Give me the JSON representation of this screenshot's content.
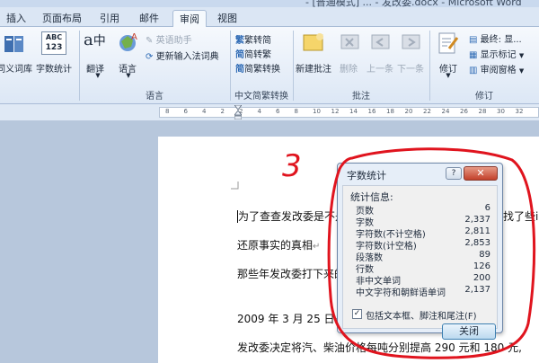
{
  "window": {
    "title": "- [普通模式] ... - 发改委.docx - Microsoft Word"
  },
  "tabs": [
    {
      "label": "插入"
    },
    {
      "label": "页面布局"
    },
    {
      "label": "引用"
    },
    {
      "label": "邮件"
    },
    {
      "label": "审阅"
    },
    {
      "label": "视图"
    }
  ],
  "ribbon": {
    "proofing": {
      "thesaurus": "同义词库",
      "word_count": "字数统计",
      "abc_text": "ABC",
      "num_text": "123"
    },
    "language": {
      "translate": "翻译",
      "language": "语言",
      "english_assistant": "英语助手",
      "update_ime": "更新输入法词典",
      "group": "语言"
    },
    "chinese_conversion": {
      "trad_to_simp": "繁转简",
      "simp_to_trad": "简转繁",
      "convert": "简繁转换",
      "group": "中文简繁转换"
    },
    "comments": {
      "new_comment": "新建批注",
      "delete": "删除",
      "previous": "上一条",
      "next": "下一条",
      "group": "批注"
    },
    "tracking": {
      "track_changes": "修订",
      "final_display": "最终: 显...",
      "show_markup": "显示标记",
      "review_pane": "审阅窗格",
      "group": "修订"
    }
  },
  "ruler": {
    "ticks": [
      "8",
      "6",
      "4",
      "2",
      "2",
      "4",
      "6",
      "8",
      "10",
      "12",
      "14",
      "16",
      "18",
      "20",
      "22",
      "24",
      "26",
      "28",
      "30",
      "32"
    ]
  },
  "document": {
    "lines": [
      "为了查查发改委是不是",
      "还原事实的真相",
      "那些年发改委打下来的",
      "2009 年 3 月 25 日",
      "发改委决定将汽、柴油价格每吨分别提高 290 元和 180 元,"
    ],
    "trailing": "找了些i",
    "return_mark": "↵"
  },
  "dialog": {
    "title": "字数统计",
    "help_label": "?",
    "close_label": "✕",
    "info_label": "统计信息:",
    "stats": [
      {
        "label": "页数",
        "value": "6"
      },
      {
        "label": "字数",
        "value": "2,337"
      },
      {
        "label": "字符数(不计空格)",
        "value": "2,811"
      },
      {
        "label": "字符数(计空格)",
        "value": "2,853"
      },
      {
        "label": "段落数",
        "value": "89"
      },
      {
        "label": "行数",
        "value": "126"
      },
      {
        "label": "非中文单词",
        "value": "200"
      },
      {
        "label": "中文字符和朝鲜语单词",
        "value": "2,137"
      }
    ],
    "include_checkbox": {
      "label": "包括文本框、脚注和尾注(F)",
      "checked_mark": "✓"
    },
    "close_button": "关闭"
  },
  "annotation": {
    "number": "3"
  },
  "colors": {
    "annotation_red": "#e0141e",
    "ribbon_top": "#f6f9fd",
    "ribbon_bottom": "#dce7f5",
    "dialog_close": "#c2402a"
  }
}
